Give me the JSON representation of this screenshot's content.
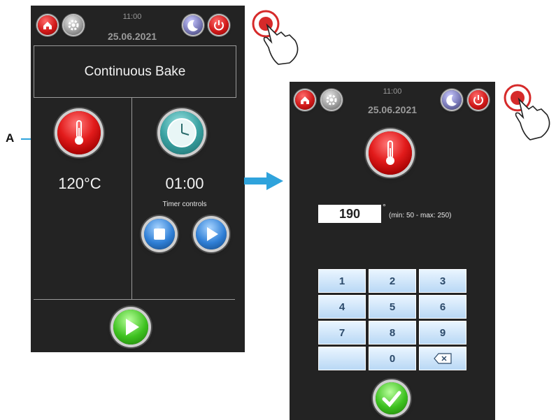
{
  "screen1": {
    "header": {
      "time": "11:00",
      "date": "25.06.2021"
    },
    "title": "Continuous Bake",
    "temperature": {
      "value": "120°C"
    },
    "timer": {
      "value": "01:00",
      "controls_label": "Timer controls"
    }
  },
  "screen2": {
    "header": {
      "time": "11:00",
      "date": "25.06.2021"
    },
    "input": {
      "value": "190",
      "unit": "°",
      "range": "(min: 50 - max: 250)"
    },
    "keypad": {
      "keys": [
        "1",
        "2",
        "3",
        "4",
        "5",
        "6",
        "7",
        "8",
        "9",
        "",
        "0"
      ]
    }
  },
  "annotation": {
    "label": "A"
  },
  "icons": {
    "home": "home-icon",
    "settings": "gear-icon",
    "night": "moon-icon",
    "power": "power-icon",
    "thermometer": "thermometer-icon",
    "clock": "clock-icon",
    "stop": "stop-icon",
    "play": "play-icon",
    "confirm": "checkmark-icon",
    "backspace": "backspace-icon",
    "arrow": "arrow-right-icon",
    "hand": "hand-pointer-icon"
  },
  "colors": {
    "screen_bg": "#232323",
    "accent_red": "#e21b1b",
    "accent_blue": "#2fa3dc",
    "accent_green": "#3dc11f"
  }
}
